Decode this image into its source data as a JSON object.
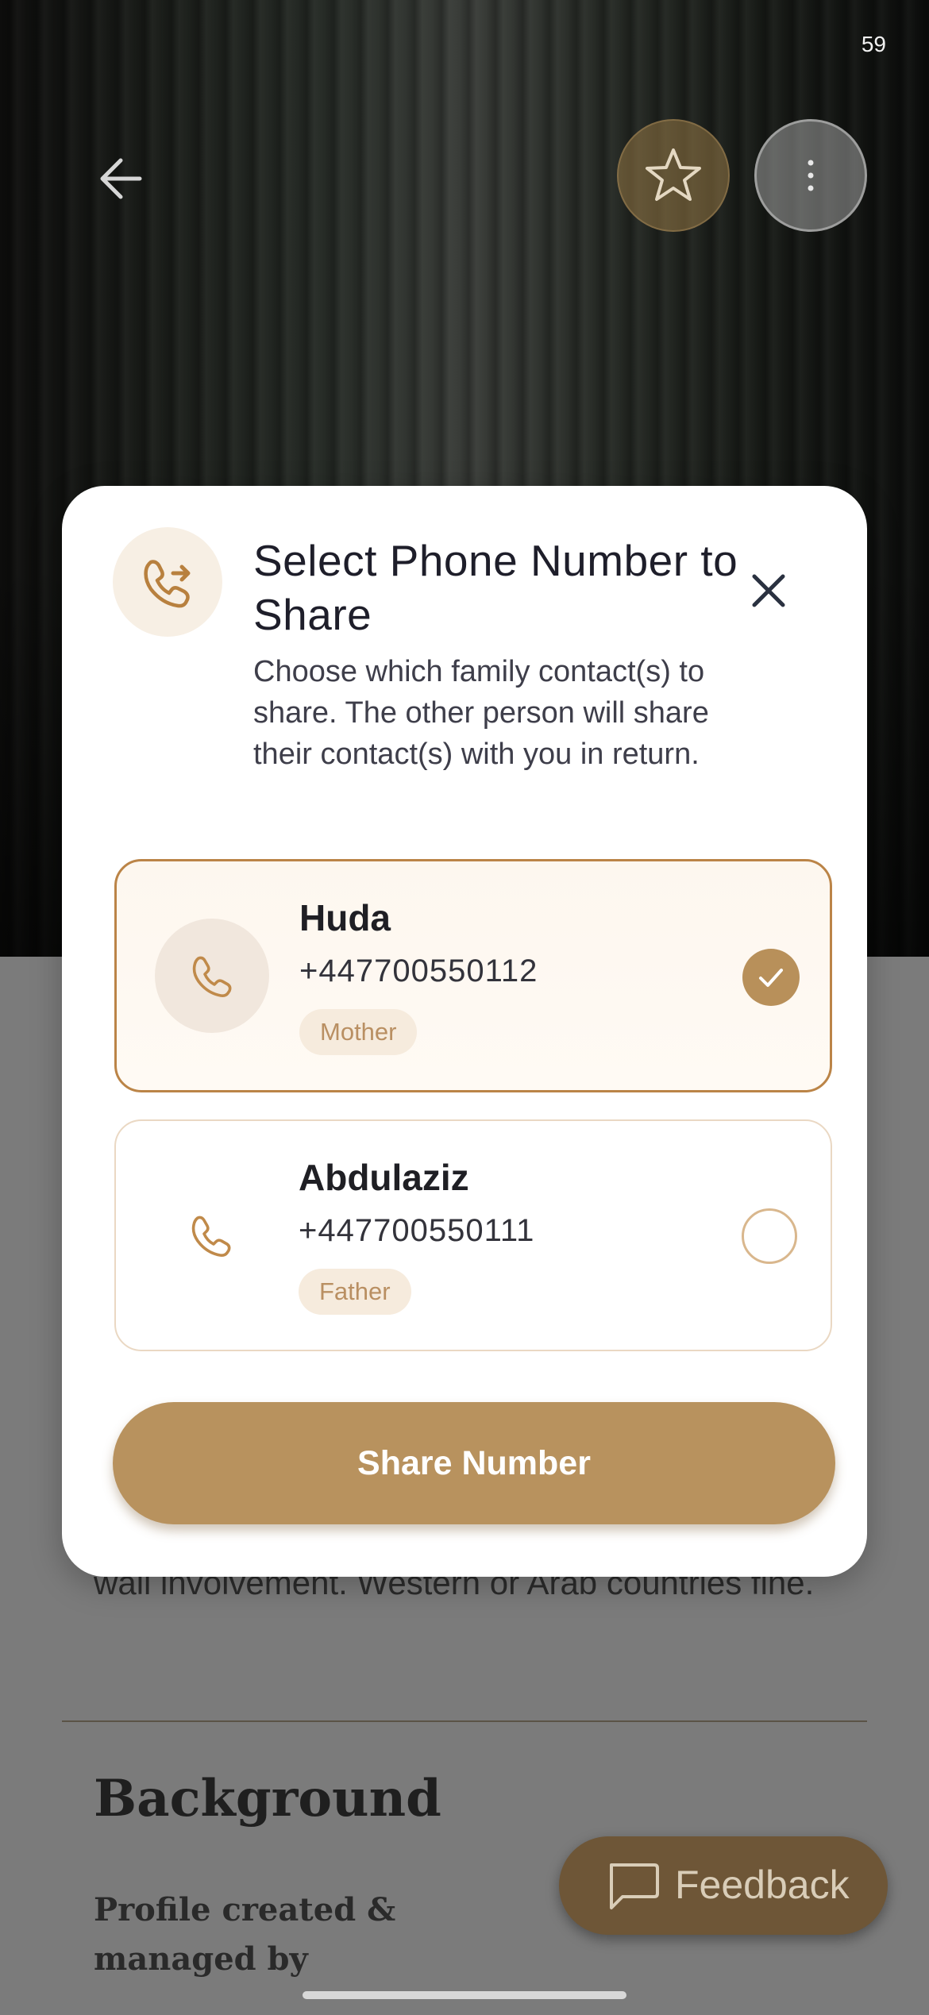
{
  "status_bar": {
    "time": "59"
  },
  "header": {
    "back_icon": "arrow-left-icon",
    "favorite_icon": "star-icon",
    "more_icon": "more-vertical-icon"
  },
  "background_page": {
    "about_text": "wali involvement. Western or Arab countries fine.",
    "section_heading": "Background",
    "section_subtext": "Profile created & managed by",
    "feedback_label": "Feedback"
  },
  "modal": {
    "header_icon": "phone-forward-icon",
    "title": "Select Phone Number to Share",
    "description": "Choose which family contact(s) to share. The other person will share their contact(s) with you in return.",
    "close_icon": "close-icon",
    "contacts": [
      {
        "name": "Huda",
        "phone": "+447700550112",
        "relation": "Mother",
        "selected": true
      },
      {
        "name": "Abdulaziz",
        "phone": "+447700550111",
        "relation": "Father",
        "selected": false
      }
    ],
    "share_button_label": "Share Number"
  },
  "colors": {
    "accent": "#b8925e",
    "accent_border": "#bb8447",
    "badge_bg": "#f6ebdd",
    "feedback_bg": "#6e5637"
  }
}
